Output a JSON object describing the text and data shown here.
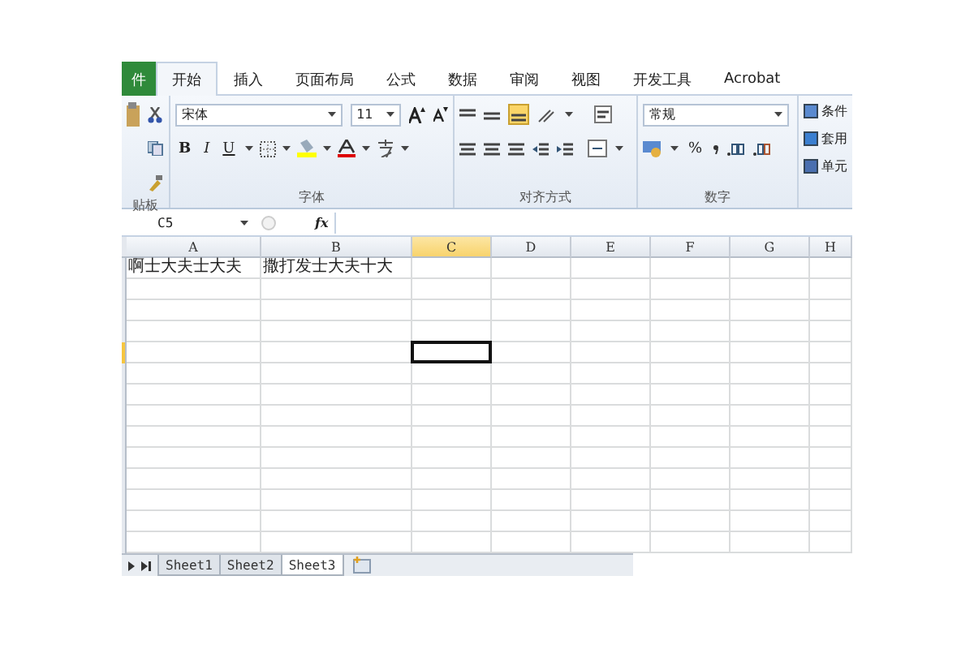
{
  "ribbon_tabs": [
    {
      "label": "件",
      "kind": "file",
      "selected": false
    },
    {
      "label": "开始",
      "kind": "tab",
      "selected": true
    },
    {
      "label": "插入",
      "kind": "tab",
      "selected": false
    },
    {
      "label": "页面布局",
      "kind": "tab",
      "selected": false
    },
    {
      "label": "公式",
      "kind": "tab",
      "selected": false
    },
    {
      "label": "数据",
      "kind": "tab",
      "selected": false
    },
    {
      "label": "审阅",
      "kind": "tab",
      "selected": false
    },
    {
      "label": "视图",
      "kind": "tab",
      "selected": false
    },
    {
      "label": "开发工具",
      "kind": "tab",
      "selected": false
    },
    {
      "label": "Acrobat",
      "kind": "tab",
      "selected": false
    }
  ],
  "clipboard": {
    "label": "贴板"
  },
  "font": {
    "name": "宋体",
    "size": "11",
    "styles": [
      "B",
      "I",
      "U"
    ],
    "label": "字体"
  },
  "alignment": {
    "label": "对齐方式"
  },
  "number": {
    "format": "常规",
    "percent": "%",
    "label": "数字"
  },
  "styles": {
    "items": [
      "条件",
      "套用",
      "单元"
    ]
  },
  "formula_bar": {
    "name_box": "C5",
    "fx": "fx"
  },
  "columns": [
    {
      "label": "A",
      "selected": false
    },
    {
      "label": "B",
      "selected": false
    },
    {
      "label": "C",
      "selected": true
    },
    {
      "label": "D",
      "selected": false
    },
    {
      "label": "E",
      "selected": false
    },
    {
      "label": "F",
      "selected": false
    },
    {
      "label": "G",
      "selected": false
    },
    {
      "label": "H",
      "selected": false
    }
  ],
  "rows": [
    {
      "selected": false,
      "cells": [
        {
          "text": "啊士大夫士大夫"
        },
        {
          "text": "撒打发士大夫十大"
        }
      ]
    },
    {
      "selected": false
    },
    {
      "selected": false
    },
    {
      "selected": false
    },
    {
      "selected": true
    },
    {
      "selected": false
    },
    {
      "selected": false
    },
    {
      "selected": false
    },
    {
      "selected": false
    },
    {
      "selected": false
    },
    {
      "selected": false
    },
    {
      "selected": false
    },
    {
      "selected": false
    },
    {
      "selected": false
    }
  ],
  "sheets": [
    {
      "label": "Sheet1",
      "selected": false
    },
    {
      "label": "Sheet2",
      "selected": false
    },
    {
      "label": "Sheet3",
      "selected": true
    }
  ]
}
